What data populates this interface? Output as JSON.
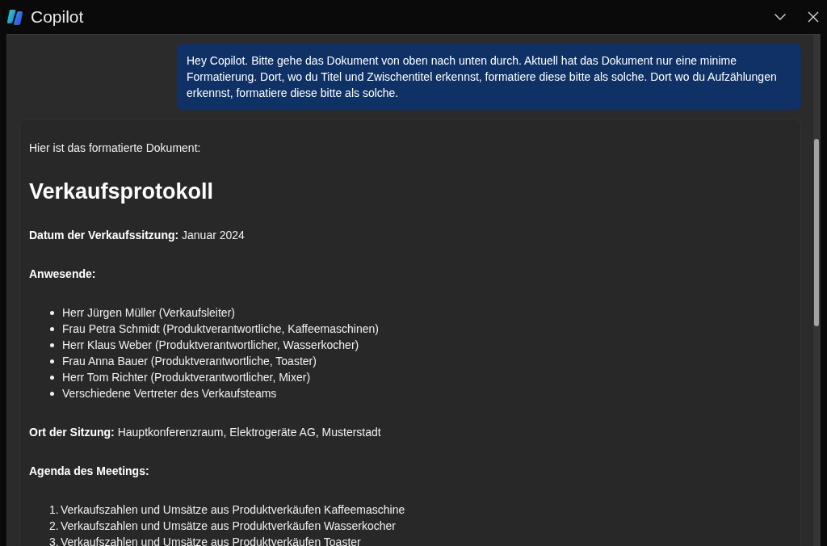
{
  "window": {
    "title": "Copilot"
  },
  "user_message": {
    "text": "Hey Copilot. Bitte gehe das Dokument von oben nach unten durch. Aktuell hat das Dokument nur eine minime Formatierung. Dort, wo du Titel und Zwischentitel erkennst, formatiere diese bitte als solche. Dort wo du Aufzählungen erkennst, formatiere diese bitte als solche."
  },
  "response": {
    "blocks": [
      {
        "kind": "paragraph",
        "text": "Hier ist das formatierte Dokument:"
      },
      {
        "kind": "heading",
        "text": "Verkaufsprotokoll"
      },
      {
        "kind": "paragraph",
        "text": "**Datum der Verkaufssitzung:** Januar 2024"
      },
      {
        "kind": "subheading",
        "text": "Anwesende:"
      },
      {
        "kind": "bullet_list",
        "items": [
          {
            "text": "Herr Jürgen Müller (Verkaufsleiter)"
          },
          {
            "text": "Frau Petra Schmidt (Produktverantwortliche, Kaffeemaschinen)"
          },
          {
            "text": "Herr Klaus Weber (Produktverantwortlicher, Wasserkocher)"
          },
          {
            "text": "Frau Anna Bauer (Produktverantwortliche, Toaster)"
          },
          {
            "text": "Herr Tom Richter (Produktverantwortlicher, Mixer)"
          },
          {
            "text": "Verschiedene Vertreter des Verkaufsteams"
          }
        ]
      },
      {
        "kind": "paragraph",
        "text": "**Ort der Sitzung:** Hauptkonferenzraum, Elektrogeräte AG, Musterstadt"
      },
      {
        "kind": "subheading",
        "text": "Agenda des Meetings:"
      },
      {
        "kind": "numbered_list",
        "items": [
          {
            "number": "1.",
            "text": "Verkaufszahlen und Umsätze aus Produktverkäufen Kaffeemaschine"
          },
          {
            "number": "2.",
            "text": "Verkaufszahlen und Umsätze aus Produktverkäufen Wasserkocher"
          },
          {
            "number": "3.",
            "text": "Verkaufszahlen und Umsätze aus Produktverkäufen Toaster"
          }
        ]
      }
    ]
  }
}
